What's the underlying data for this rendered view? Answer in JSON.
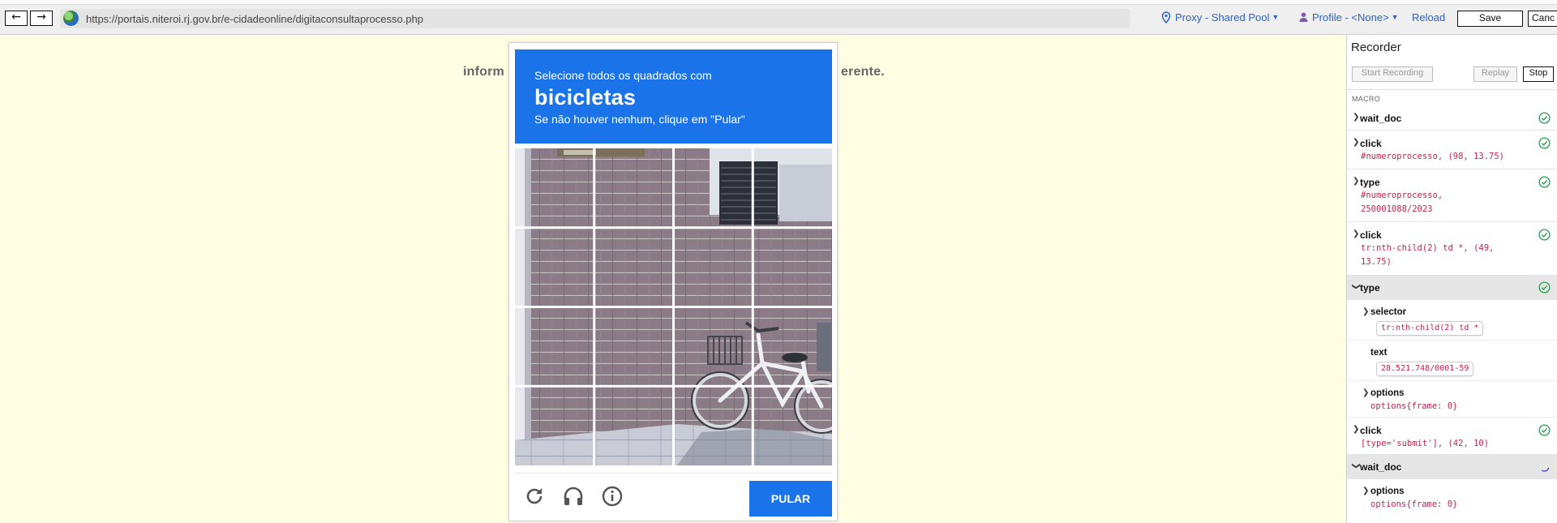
{
  "toolbar": {
    "back": "←",
    "forward": "→",
    "url": "https://portais.niteroi.rj.gov.br/e-cidadeonline/digitaconsultaprocesso.php",
    "proxy": "Proxy - Shared Pool",
    "profile": "Profile - <None>",
    "reload": "Reload",
    "save": "Save",
    "cancel": "Canc"
  },
  "page": {
    "text_left": "inform",
    "text_right": "erente."
  },
  "captcha": {
    "instruction": "Selecione todos os quadrados com",
    "target": "bicicletas",
    "hint": "Se não houver nenhum, clique em \"Pular\"",
    "skip": "PULAR",
    "colors": {
      "header": "#1a73e8",
      "button": "#1a73e8"
    },
    "icons": [
      "reload-icon",
      "headphones-icon",
      "info-icon"
    ]
  },
  "recorder": {
    "title": "Recorder",
    "start": "Start Recording",
    "replay": "Replay",
    "stop": "Stop",
    "macro_label": "MACRO",
    "steps": [
      {
        "name": "wait_doc",
        "status": "done"
      },
      {
        "name": "click",
        "detail": "#numeroprocesso, (98, 13.75)",
        "status": "done"
      },
      {
        "name": "type",
        "detail": "#numeroprocesso,\n250001088/2023",
        "status": "done"
      },
      {
        "name": "click",
        "detail": "tr:nth-child(2) td *, (49,\n13.75)",
        "status": "done"
      },
      {
        "name": "type",
        "status": "done",
        "expanded": true,
        "selector_label": "selector",
        "selector": "tr:nth-child(2) td *",
        "text_label": "text",
        "text": "28.521.748/0001-59",
        "options_label": "options",
        "options": "options{frame: 0}"
      },
      {
        "name": "click",
        "detail": "[type='submit'], (42, 10)",
        "status": "done"
      },
      {
        "name": "wait_doc",
        "status": "running",
        "expanded": true,
        "options_label": "options",
        "options": "options{frame: 0}"
      }
    ]
  }
}
